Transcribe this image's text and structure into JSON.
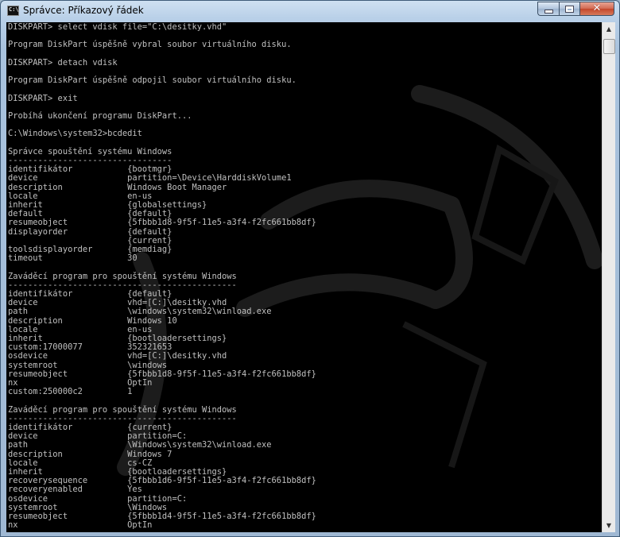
{
  "window": {
    "title": "Správce: Příkazový řádek",
    "icon_label": "C:\\",
    "icons": {
      "app": "cmd-icon",
      "minimize": "minimize-icon",
      "maximize": "maximize-icon",
      "close": "close-icon",
      "scroll_up": "scroll-up-arrow-icon",
      "scroll_down": "scroll-down-arrow-icon"
    },
    "close_glyph": "✕",
    "scroll_up_glyph": "▲",
    "scroll_down_glyph": "▼"
  },
  "colors": {
    "console_bg": "#000000",
    "console_text": "#c0c0c0",
    "close_button": "#c4472b"
  },
  "console": {
    "lines": [
      "DISKPART> select vdisk file=\"C:\\desitky.vhd\"",
      "",
      "Program DiskPart úspěšně vybral soubor virtuálního disku.",
      "",
      "DISKPART> detach vdisk",
      "",
      "Program DiskPart úspěšně odpojil soubor virtuálního disku.",
      "",
      "DISKPART> exit",
      "",
      "Probíhá ukončení programu DiskPart...",
      "",
      "C:\\Windows\\system32>bcdedit",
      "",
      "Správce spouštění systému Windows",
      "---------------------------------",
      "identifikátor           {bootmgr}",
      "device                  partition=\\Device\\HarddiskVolume1",
      "description             Windows Boot Manager",
      "locale                  en-us",
      "inherit                 {globalsettings}",
      "default                 {default}",
      "resumeobject            {5fbbb1d8-9f5f-11e5-a3f4-f2fc661bb8df}",
      "displayorder            {default}",
      "                        {current}",
      "toolsdisplayorder       {memdiag}",
      "timeout                 30",
      "",
      "Zaváděcí program pro spouštění systému Windows",
      "----------------------------------------------",
      "identifikátor           {default}",
      "device                  vhd=[C:]\\desitky.vhd",
      "path                    \\windows\\system32\\winload.exe",
      "description             Windows 10",
      "locale                  en-us",
      "inherit                 {bootloadersettings}",
      "custom:17000077         352321653",
      "osdevice                vhd=[C:]\\desitky.vhd",
      "systemroot              \\windows",
      "resumeobject            {5fbbb1d8-9f5f-11e5-a3f4-f2fc661bb8df}",
      "nx                      OptIn",
      "custom:250000c2         1",
      "",
      "Zaváděcí program pro spouštění systému Windows",
      "----------------------------------------------",
      "identifikátor           {current}",
      "device                  partition=C:",
      "path                    \\Windows\\system32\\winload.exe",
      "description             Windows 7",
      "locale                  cs-CZ",
      "inherit                 {bootloadersettings}",
      "recoverysequence        {5fbbb1d6-9f5f-11e5-a3f4-f2fc661bb8df}",
      "recoveryenabled         Yes",
      "osdevice                partition=C:",
      "systemroot              \\Windows",
      "resumeobject            {5fbbb1d4-9f5f-11e5-a3f4-f2fc661bb8df}",
      "nx                      OptIn"
    ]
  }
}
